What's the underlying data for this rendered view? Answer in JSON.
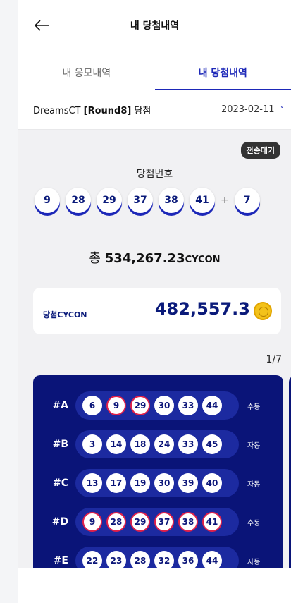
{
  "header": {
    "title": "내 당첨내역",
    "back_icon": "arrow-left-icon"
  },
  "tabs": [
    {
      "label": "내 응모내역",
      "active": false
    },
    {
      "label": "내 당첨내역",
      "active": true
    }
  ],
  "round_select": {
    "prefix": "DreamsCT ",
    "round": "[Round8]",
    "suffix": " 당첨",
    "date": "2023-02-11",
    "chevron": "˅"
  },
  "status_badge": "전송대기",
  "winning": {
    "label": "당첨번호",
    "numbers": [
      "9",
      "28",
      "29",
      "37",
      "38",
      "41"
    ],
    "plus": "+",
    "bonus": "7"
  },
  "total": {
    "prefix": "총 ",
    "amount": "534,267.23",
    "unit": "CYCON"
  },
  "cycon_card": {
    "label": "당첨CYCON",
    "value": "482,557.3",
    "icon": "coin-icon"
  },
  "pager": "1/7",
  "ticket": {
    "rows": [
      {
        "label": "#A",
        "numbers": [
          "6",
          "9",
          "29",
          "30",
          "33",
          "44"
        ],
        "hits": [
          false,
          true,
          true,
          false,
          false,
          false
        ],
        "mode": "수동"
      },
      {
        "label": "#B",
        "numbers": [
          "3",
          "14",
          "18",
          "24",
          "33",
          "45"
        ],
        "hits": [
          false,
          false,
          false,
          false,
          false,
          false
        ],
        "mode": "자동"
      },
      {
        "label": "#C",
        "numbers": [
          "13",
          "17",
          "19",
          "30",
          "39",
          "40"
        ],
        "hits": [
          false,
          false,
          false,
          false,
          false,
          false
        ],
        "mode": "자동"
      },
      {
        "label": "#D",
        "numbers": [
          "9",
          "28",
          "29",
          "37",
          "38",
          "41"
        ],
        "hits": [
          true,
          true,
          true,
          true,
          true,
          true
        ],
        "mode": "수동"
      },
      {
        "label": "#E",
        "numbers": [
          "22",
          "23",
          "28",
          "32",
          "36",
          "44"
        ],
        "hits": [
          false,
          false,
          false,
          false,
          false,
          false
        ],
        "mode": "자동"
      }
    ]
  },
  "colors": {
    "accent": "#1d28b8",
    "ticket_bg": "#0a1478",
    "hit_ring": "#e0204a",
    "coin": "#f3c21a"
  }
}
